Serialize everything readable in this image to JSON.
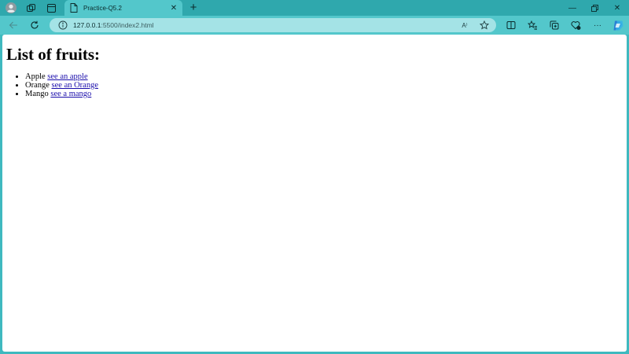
{
  "browser": {
    "tab": {
      "title": "Practice-Q5.2"
    },
    "address": {
      "host": "127.0.0.1",
      "path": ":5500/index2.html"
    },
    "read_aloud_label": "A⁾",
    "colors": {
      "frame": "#3fb9bf",
      "toolbar": "#53c7cb",
      "address_bg": "#a4e3e6"
    }
  },
  "page": {
    "heading": "List of fruits:",
    "fruits": [
      {
        "name": "Apple",
        "link": "see an apple"
      },
      {
        "name": "Orange",
        "link": "see an Orange"
      },
      {
        "name": "Mango",
        "link": "see a mango"
      }
    ]
  }
}
